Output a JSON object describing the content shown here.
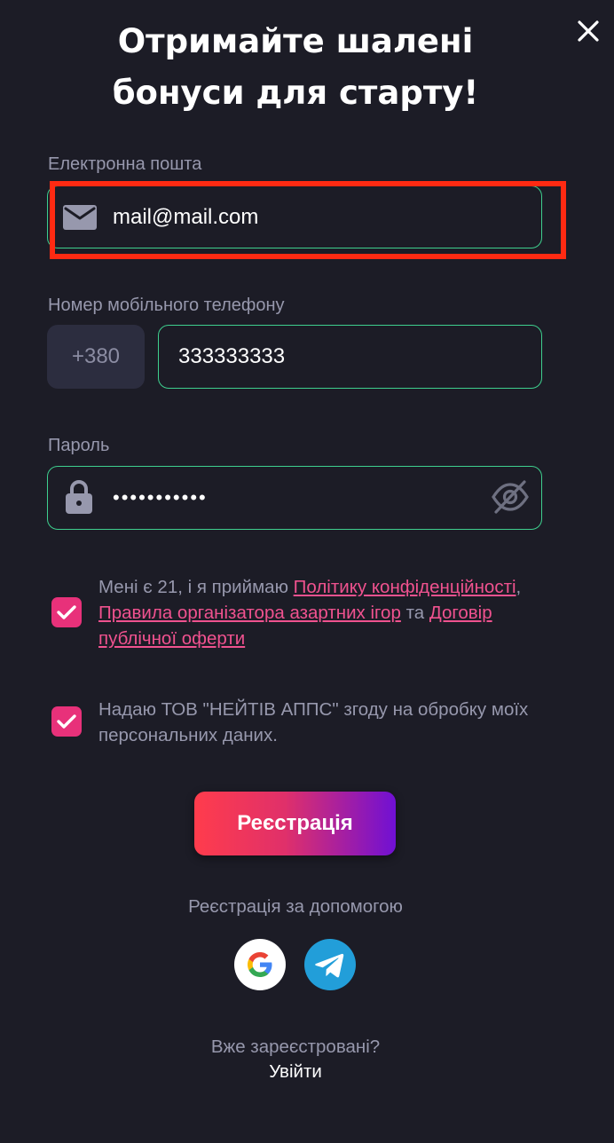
{
  "header": {
    "title_line1": "Отримайте шалені",
    "title_line2": "бонуси для старту!"
  },
  "email": {
    "label": "Електронна пошта",
    "value": "mail@mail.com"
  },
  "phone": {
    "label": "Номер мобільного телефону",
    "prefix": "+380",
    "value": "333333333"
  },
  "password": {
    "label": "Пароль",
    "masked_value": "•••••••••••"
  },
  "consent_terms": {
    "checked": true,
    "text_before": "Мені є 21, і я приймаю ",
    "link_privacy": "Політику конфіденційності",
    "sep1": ", ",
    "link_rules": "Правила організатора азартних ігор",
    "sep2": " та ",
    "link_offer": "Договір публічної оферти"
  },
  "consent_data": {
    "checked": true,
    "text": "Надаю ТОВ \"НЕЙТІВ АППС\" згоду на обробку моїх персональних даних."
  },
  "register_button": "Реєстрація",
  "social": {
    "label": "Реєстрація за допомогою",
    "providers": [
      "google-icon",
      "telegram-icon"
    ]
  },
  "footer": {
    "already_registered": "Вже зареєстровані?",
    "login": "Увійти"
  },
  "colors": {
    "background": "#1c1c26",
    "field_border": "#3ecf8e",
    "accent_pink": "#e8317a",
    "link": "#f0528f",
    "highlight": "#ff2a12"
  }
}
